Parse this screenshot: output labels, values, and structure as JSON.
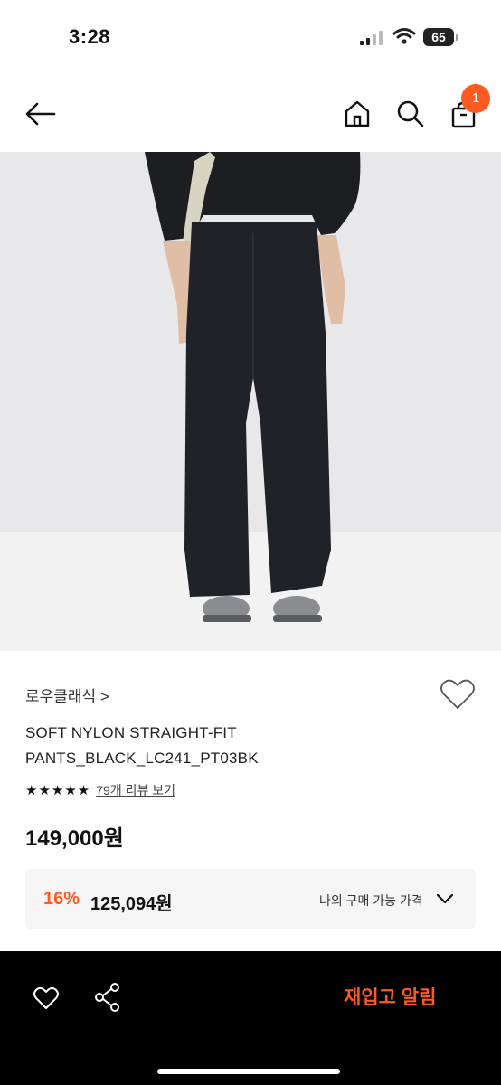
{
  "status_bar": {
    "time": "3:28",
    "battery": "65"
  },
  "nav": {
    "cart_count": "1",
    "accent_color": "#ff5a1f"
  },
  "icons": {
    "back": "back-arrow-icon",
    "home": "home-icon",
    "search": "search-icon",
    "cart": "cart-icon",
    "wish": "heart-icon",
    "share": "share-icon",
    "chevron": "chevron-down-icon"
  },
  "product": {
    "brand": "로우클래식 >",
    "name": "SOFT NYLON STRAIGHT-FIT PANTS_BLACK_LC241_PT03BK",
    "stars": "★★★★★",
    "reviews_link": "79개 리뷰 보기",
    "price": "149,000원",
    "discount_rate": "16%",
    "discount_price": "125,094원",
    "buy_price_label": "나의 구매 가능 가격"
  },
  "bottom_bar": {
    "restock_alert": "재입고 알림"
  }
}
